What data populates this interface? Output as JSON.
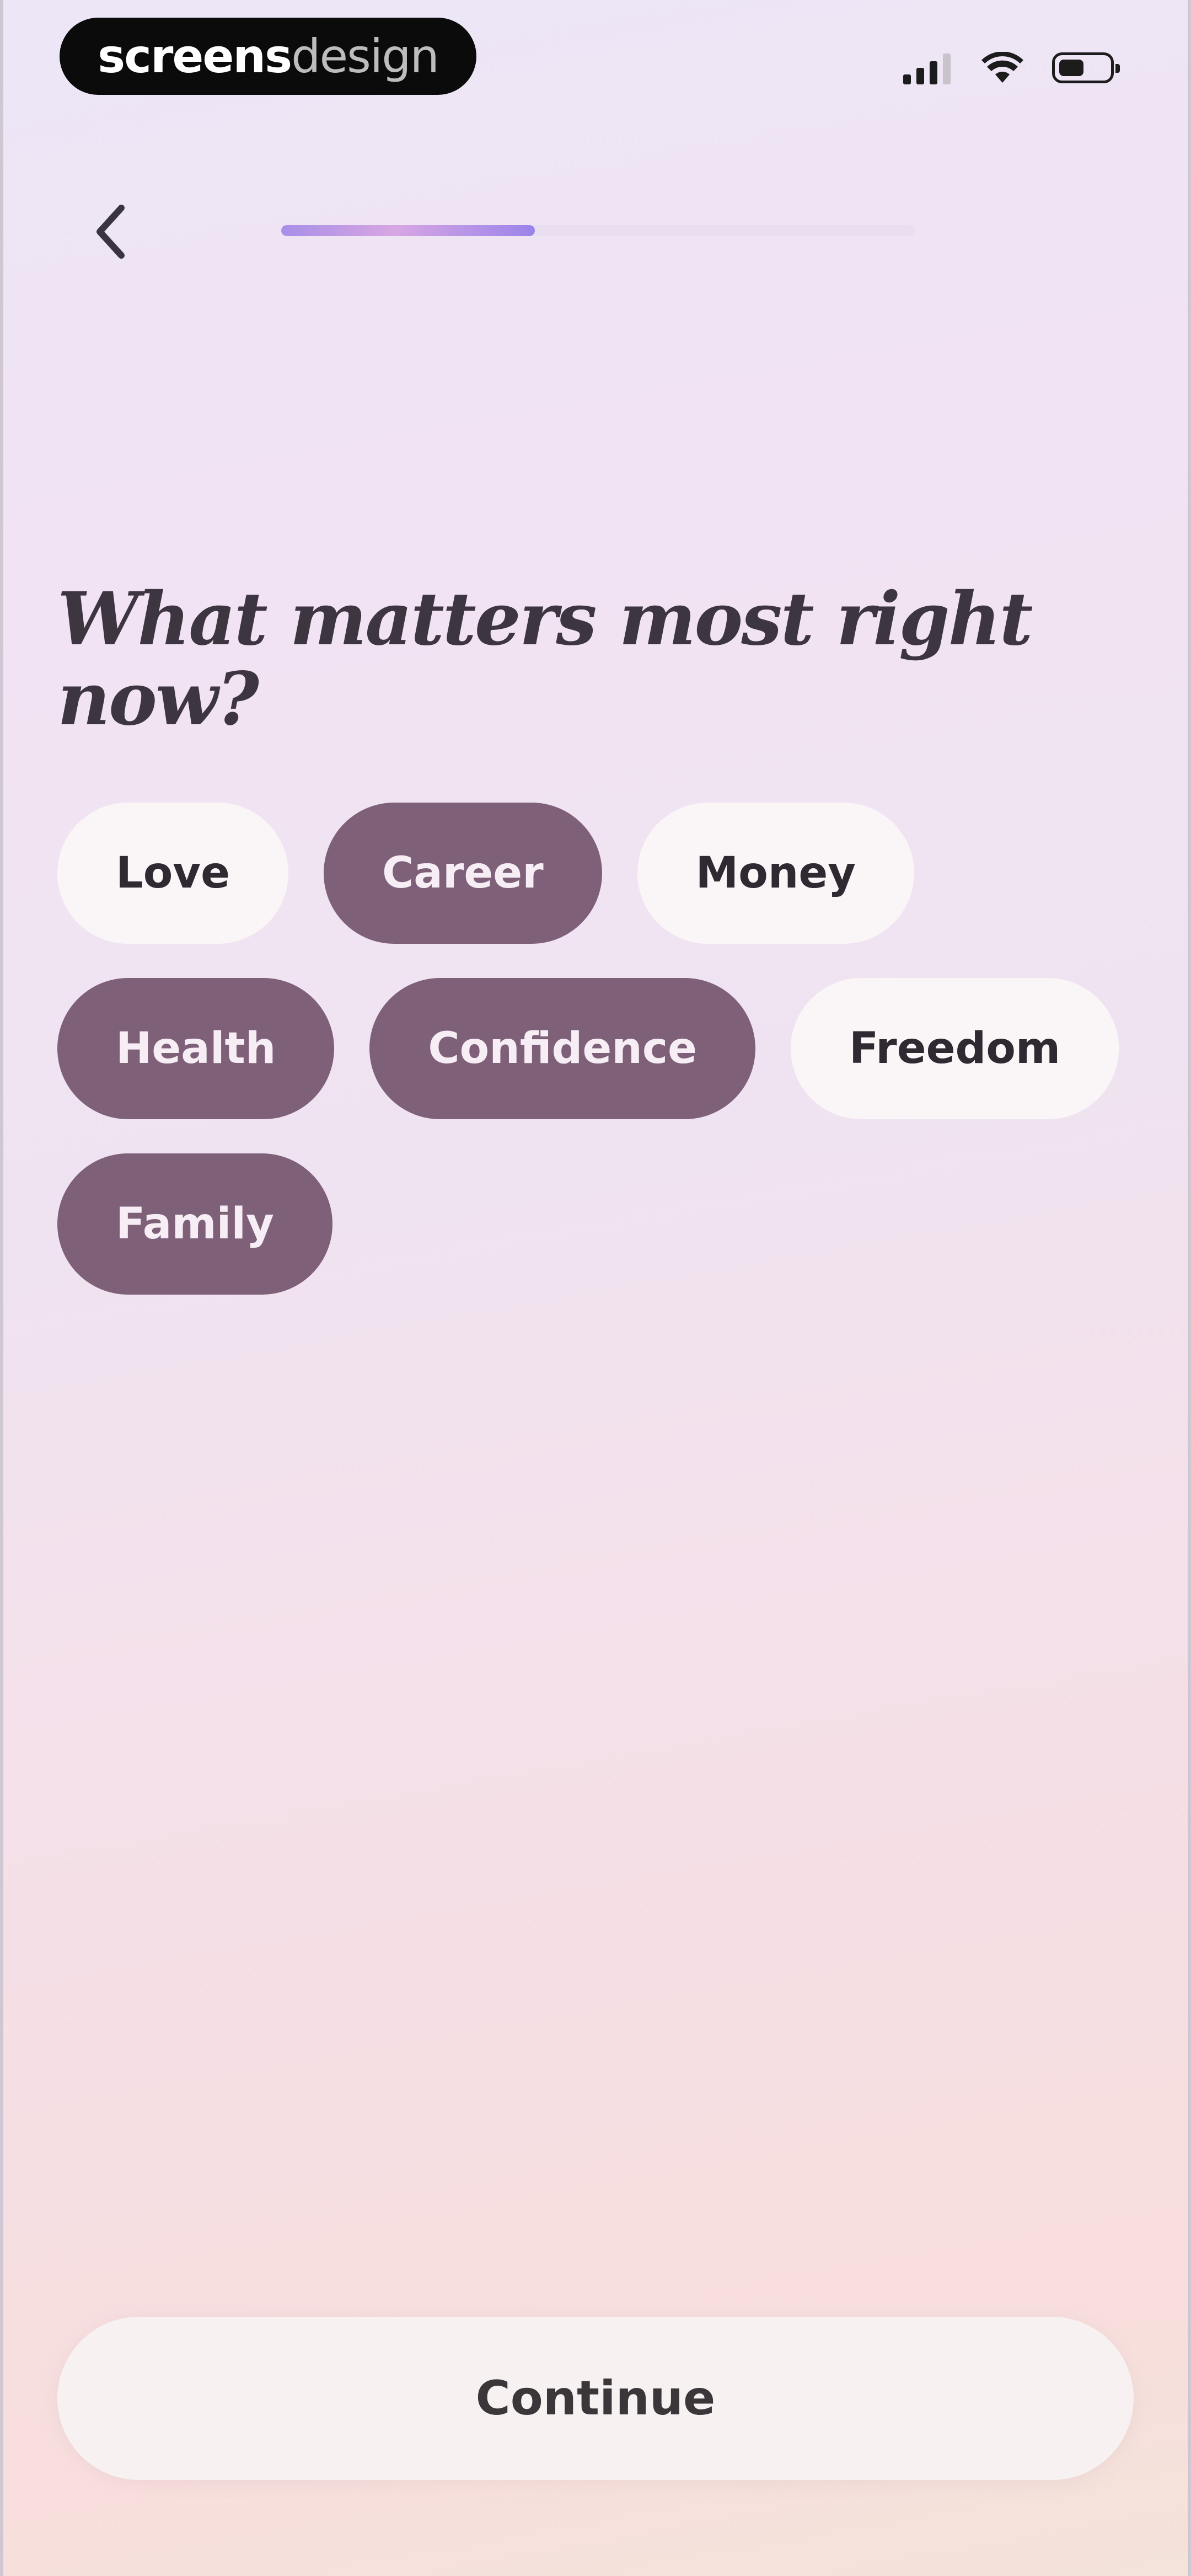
{
  "status_bar": {
    "logo_strong": "screens",
    "logo_light": "design"
  },
  "progress": {
    "fraction": 0.4
  },
  "question": "What matters most right now?",
  "chips": [
    {
      "label": "Love",
      "selected": false
    },
    {
      "label": "Career",
      "selected": true
    },
    {
      "label": "Money",
      "selected": false
    },
    {
      "label": "Health",
      "selected": true
    },
    {
      "label": "Confidence",
      "selected": true
    },
    {
      "label": "Freedom",
      "selected": false
    },
    {
      "label": "Family",
      "selected": true
    }
  ],
  "continue_label": "Continue",
  "icons": {
    "back": "chevron-left-icon",
    "signal": "cellular-signal-icon",
    "wifi": "wifi-icon",
    "battery": "battery-icon"
  },
  "colors": {
    "chip_selected": "#7f6079",
    "chip_unselected": "#faf6f8",
    "progress_fill": "#a78fe8"
  }
}
